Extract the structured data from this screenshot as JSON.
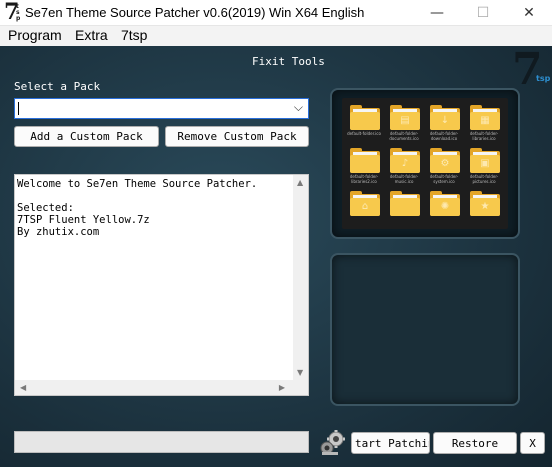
{
  "window": {
    "title": "Se7en Theme Source Patcher v0.6(2019) Win X64 English",
    "logo_text": "7",
    "logo_sub": "tsp",
    "min_glyph": "—",
    "max_glyph": "☐",
    "close_glyph": "✕"
  },
  "menu": {
    "items": [
      {
        "label": "Program"
      },
      {
        "label": "Extra"
      },
      {
        "label": "7tsp"
      }
    ]
  },
  "main": {
    "section_title": "Fixit Tools",
    "logo_text": "7",
    "logo_sub": "tsp",
    "select_label": "Select a Pack",
    "select_value": "",
    "add_button": "Add a Custom Pack",
    "remove_button": "Remove Custom Pack",
    "log_text": "Welcome to Se7en Theme Source Patcher.\n\nSelected:\n7TSP Fluent Yellow.7z\nBy zhutix.com",
    "preview_icons": [
      {
        "caption": "default-folder.ico",
        "icon": "plain"
      },
      {
        "caption": "default-folder-documents.ico",
        "icon": "document"
      },
      {
        "caption": "default-folder-download.ico",
        "icon": "download"
      },
      {
        "caption": "default-folder-libraries.ico",
        "icon": "libraries"
      },
      {
        "caption": "default-folder-libraries2.ico",
        "icon": "plain"
      },
      {
        "caption": "default-folder-music.ico",
        "icon": "music"
      },
      {
        "caption": "default-folder-system.ico",
        "icon": "settings"
      },
      {
        "caption": "default-folder-pictures.ico",
        "icon": "pictures"
      },
      {
        "caption": "",
        "icon": "home"
      },
      {
        "caption": "",
        "icon": "plain"
      },
      {
        "caption": "",
        "icon": "network"
      },
      {
        "caption": "",
        "icon": "favorites"
      }
    ]
  },
  "footer": {
    "progress": 0,
    "start_button": "tart Patchin",
    "restore_button": "Restore",
    "close_button": "X"
  },
  "colors": {
    "accent": "#2a6fdb",
    "folder_front": "#f7c94c",
    "folder_back": "#e3a528",
    "background": "#1d3340"
  }
}
